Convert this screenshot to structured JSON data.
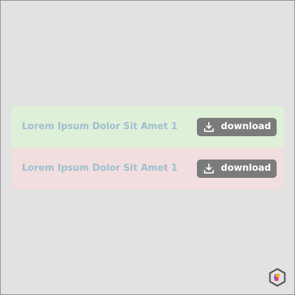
{
  "rows": [
    {
      "label": "Lorem Ipsum Dolor Sit Amet 1",
      "button_label": "download",
      "background": "#dff0d8"
    },
    {
      "label": "Lorem Ipsum Dolor Sit Amet 1",
      "button_label": "download",
      "background": "#f2dede"
    }
  ],
  "icons": {
    "download": "download-icon",
    "logo": "hexagon-logo-icon"
  },
  "colors": {
    "page_background": "#e2e2e2",
    "label_text": "#9dbfd0",
    "button_background": "#7b7b7b",
    "button_text": "#ffffff"
  }
}
